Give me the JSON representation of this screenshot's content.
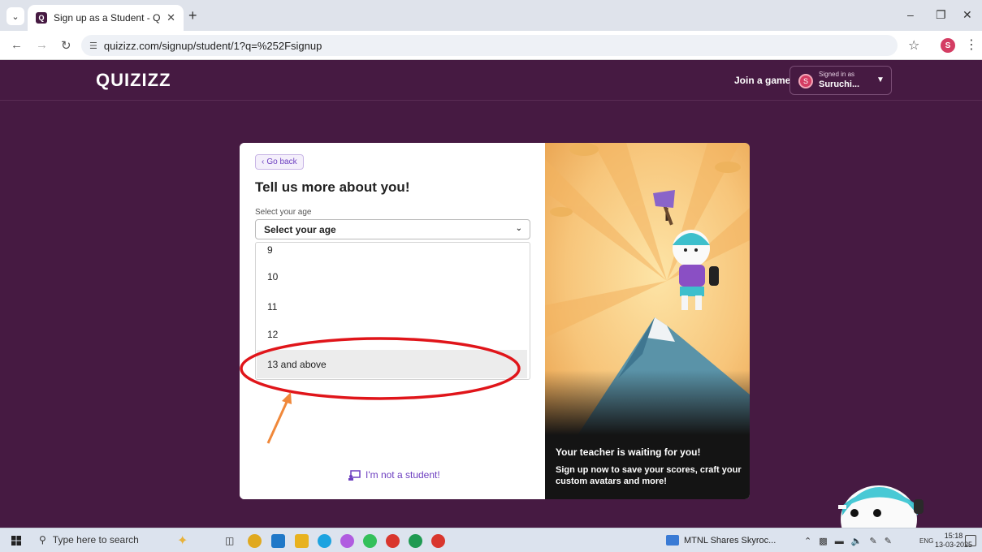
{
  "browser": {
    "tab_title": "Sign up as a Student - Quizizz",
    "url": "quizizz.com/signup/student/1?q=%252Fsignup",
    "profile_initial": "S"
  },
  "header": {
    "logo": "QUIZIZZ",
    "join_label": "Join a game",
    "signed_caption": "Signed in as",
    "signed_name": "Suruchi...",
    "avatar_initial": "S"
  },
  "form": {
    "go_back": "Go back",
    "heading": "Tell us more about you!",
    "age_label": "Select your age",
    "select_value": "Select your age",
    "options": [
      "9",
      "10",
      "11",
      "12",
      "13 and above"
    ],
    "selected_option": "13 and above",
    "not_student": "I'm not a student!"
  },
  "promo": {
    "title": "Your teacher is waiting for you!",
    "text": "Sign up now to save your scores, craft your custom avatars and more!"
  },
  "taskbar": {
    "search_placeholder": "Type here to search",
    "running_app": "MTNL Shares Skyroc...",
    "language": "ENG",
    "time": "15:18",
    "date": "13-03-2025"
  },
  "colors": {
    "brand_purple": "#461a42",
    "accent_violet": "#6d3fc0",
    "annotation_red": "#e0151a",
    "annotation_orange": "#f0883a"
  }
}
